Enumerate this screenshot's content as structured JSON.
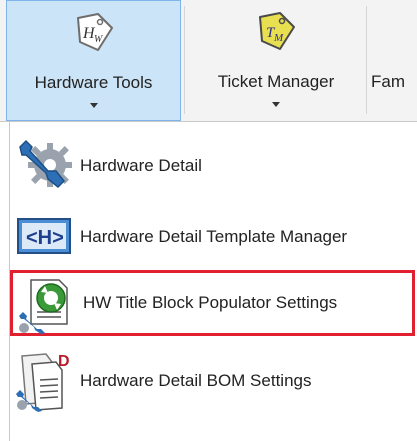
{
  "ribbon": {
    "buttons": [
      {
        "label": "Hardware Tools",
        "icon": "hw-tag-icon",
        "active": true
      },
      {
        "label": "Ticket Manager",
        "icon": "tm-tag-icon",
        "active": false
      },
      {
        "label": "Fam",
        "icon": "",
        "active": false
      }
    ]
  },
  "menu": {
    "items": [
      {
        "label": "Hardware Detail",
        "icon": "wrench-gear-icon"
      },
      {
        "label": "Hardware Detail Template Manager",
        "icon": "h-tag-code-icon"
      },
      {
        "label": "HW Title Block Populator Settings",
        "icon": "sync-settings-icon",
        "highlighted": true
      },
      {
        "label": "Hardware Detail BOM Settings",
        "icon": "bom-document-icon"
      }
    ]
  },
  "colors": {
    "active_bg": "#cce4f7",
    "active_border": "#7eb4ea",
    "highlight_border": "#e0202e",
    "tm_tag": "#e8e050",
    "sync_green": "#3a9a3a"
  }
}
